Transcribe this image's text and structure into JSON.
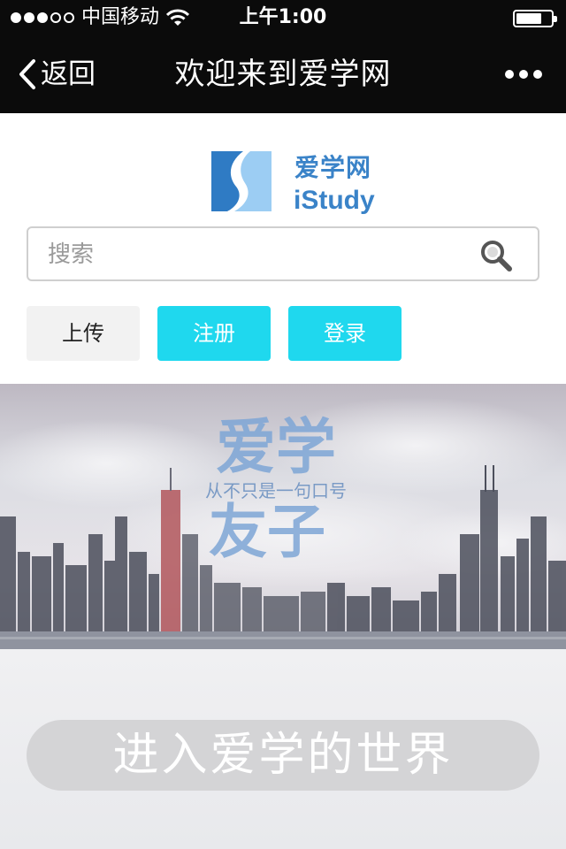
{
  "status_bar": {
    "carrier": "中国移动",
    "time": "上午1:00"
  },
  "nav": {
    "back_label": "返回",
    "title": "欢迎来到爱学网"
  },
  "logo": {
    "name_cn": "爱学网",
    "name_en": "iStudy"
  },
  "search": {
    "placeholder": "搜索"
  },
  "buttons": {
    "upload": "上传",
    "register": "注册",
    "login": "登录"
  },
  "banner": {
    "title_top": "爱学",
    "title_bottom": "友子",
    "slogan": "从不只是一句口号"
  },
  "enter_button": "进入爱学的世界",
  "colors": {
    "accent": "#1fd8ee",
    "brand_blue": "#3a83c8",
    "bar_bg": "#0b0b0b"
  }
}
